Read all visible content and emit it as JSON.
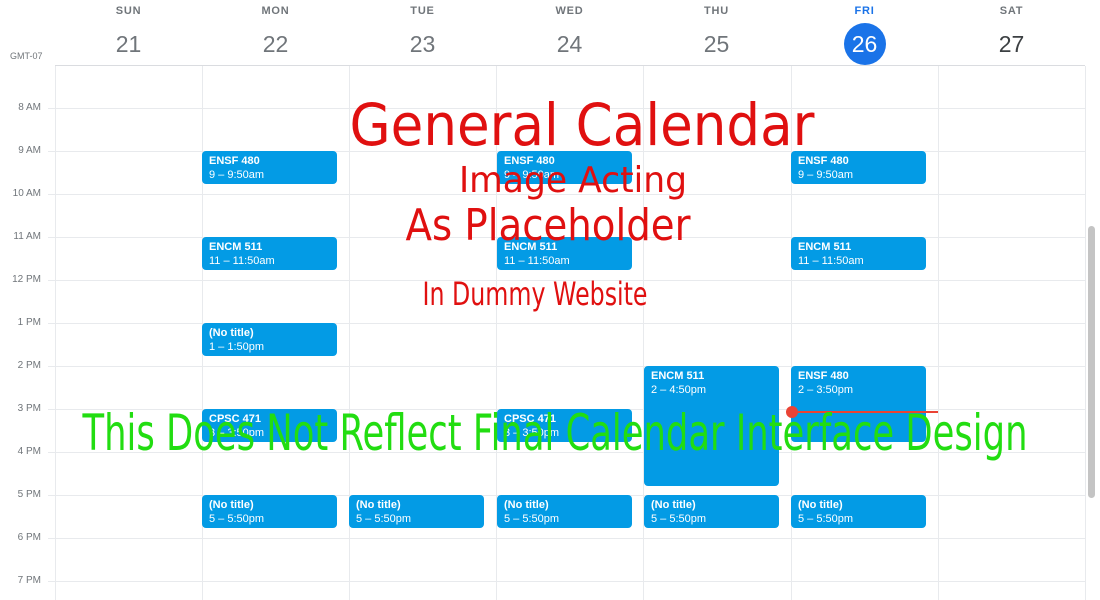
{
  "header": {
    "timezone": "GMT-07",
    "days": [
      {
        "name": "SUN",
        "num": "21"
      },
      {
        "name": "MON",
        "num": "22"
      },
      {
        "name": "TUE",
        "num": "23"
      },
      {
        "name": "WED",
        "num": "24"
      },
      {
        "name": "THU",
        "num": "25"
      },
      {
        "name": "FRI",
        "num": "26",
        "today": true
      },
      {
        "name": "SAT",
        "num": "27"
      }
    ]
  },
  "hours": [
    "8 AM",
    "9 AM",
    "10 AM",
    "11 AM",
    "12 PM",
    "1 PM",
    "2 PM",
    "3 PM",
    "4 PM",
    "5 PM",
    "6 PM",
    "7 PM"
  ],
  "events": {
    "mon_ensf": {
      "title": "ENSF 480",
      "time": "9 – 9:50am"
    },
    "mon_encm": {
      "title": "ENCM 511",
      "time": "11 – 11:50am"
    },
    "mon_notitle1": {
      "title": "(No title)",
      "time": "1 – 1:50pm"
    },
    "mon_cpsc": {
      "title": "CPSC 471",
      "time": "3 – 3:50pm"
    },
    "mon_notitle5": {
      "title": "(No title)",
      "time": "5 – 5:50pm"
    },
    "tue_notitle5": {
      "title": "(No title)",
      "time": "5 – 5:50pm"
    },
    "wed_ensf": {
      "title": "ENSF 480",
      "time": "9 – 9:50am"
    },
    "wed_encm": {
      "title": "ENCM 511",
      "time": "11 – 11:50am"
    },
    "wed_cpsc": {
      "title": "CPSC 471",
      "time": "3 – 3:50pm"
    },
    "wed_notitle5": {
      "title": "(No title)",
      "time": "5 – 5:50pm"
    },
    "thu_encm": {
      "title": "ENCM 511",
      "time": "2 – 4:50pm"
    },
    "thu_notitle5": {
      "title": "(No title)",
      "time": "5 – 5:50pm"
    },
    "fri_ensf9": {
      "title": "ENSF 480",
      "time": "9 – 9:50am"
    },
    "fri_encm": {
      "title": "ENCM 511",
      "time": "11 – 11:50am"
    },
    "fri_ensf2": {
      "title": "ENSF 480",
      "time": "2 – 3:50pm"
    },
    "fri_notitle5": {
      "title": "(No title)",
      "time": "5 – 5:50pm"
    }
  },
  "overlay": {
    "red_lines": [
      "General Calendar",
      "Image Acting",
      "As Placeholder",
      "In Dummy Website"
    ],
    "green_line": "This Does Not Reflect Final Calendar Interface Design",
    "red_color": "#e01010",
    "green_color": "#22dd11"
  },
  "colors": {
    "event": "#039be5",
    "today": "#1a73e8",
    "now_indicator": "#ea4335"
  }
}
